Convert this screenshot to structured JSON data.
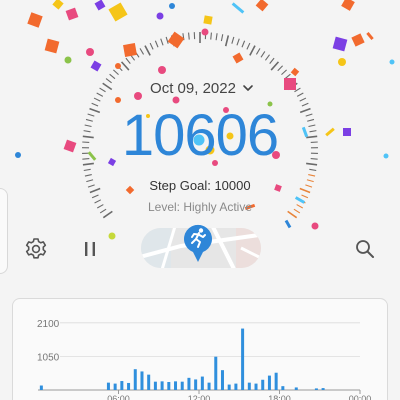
{
  "date": {
    "label": "Oct 09, 2022"
  },
  "steps": {
    "count": "10606",
    "goal_label": "Step Goal: ",
    "goal_value": "10000",
    "level_label": "Level: ",
    "level_value": "Highly Active"
  },
  "colors": {
    "accent": "#2e86d8",
    "gauge_tick": "#6a6a6a",
    "gauge_highlight": "#e8843a",
    "bar": "#2f8fdd"
  },
  "icons": {
    "settings": "gear-icon",
    "pause": "pause-icon",
    "run": "running-person-icon",
    "search": "search-icon",
    "dropdown": "chevron-down-icon"
  },
  "chart_data": {
    "type": "bar",
    "title": "",
    "xlabel": "",
    "ylabel": "",
    "ylim": [
      0,
      2250
    ],
    "y_ticks": [
      "2100",
      "1050"
    ],
    "y_tick_values": [
      2100,
      1050
    ],
    "x_tick_labels": [
      "06:00",
      "12:00",
      "18:00",
      "00:00"
    ],
    "x_tick_hours": [
      6,
      12,
      18,
      24
    ],
    "x_range_hours": [
      0,
      24
    ],
    "bars": [
      {
        "hour": 0.25,
        "value": 140
      },
      {
        "hour": 5.25,
        "value": 230
      },
      {
        "hour": 5.75,
        "value": 200
      },
      {
        "hour": 6.25,
        "value": 280
      },
      {
        "hour": 6.75,
        "value": 220
      },
      {
        "hour": 7.25,
        "value": 650
      },
      {
        "hour": 7.75,
        "value": 580
      },
      {
        "hour": 8.25,
        "value": 480
      },
      {
        "hour": 8.75,
        "value": 260
      },
      {
        "hour": 9.25,
        "value": 270
      },
      {
        "hour": 9.75,
        "value": 250
      },
      {
        "hour": 10.25,
        "value": 270
      },
      {
        "hour": 10.75,
        "value": 260
      },
      {
        "hour": 11.25,
        "value": 380
      },
      {
        "hour": 11.75,
        "value": 330
      },
      {
        "hour": 12.25,
        "value": 420
      },
      {
        "hour": 12.75,
        "value": 230
      },
      {
        "hour": 13.25,
        "value": 1040
      },
      {
        "hour": 13.75,
        "value": 620
      },
      {
        "hour": 14.25,
        "value": 170
      },
      {
        "hour": 14.75,
        "value": 200
      },
      {
        "hour": 15.25,
        "value": 1920
      },
      {
        "hour": 15.75,
        "value": 230
      },
      {
        "hour": 16.25,
        "value": 200
      },
      {
        "hour": 16.75,
        "value": 320
      },
      {
        "hour": 17.25,
        "value": 450
      },
      {
        "hour": 17.75,
        "value": 540
      },
      {
        "hour": 18.25,
        "value": 120
      },
      {
        "hour": 19.25,
        "value": 80
      },
      {
        "hour": 20.75,
        "value": 50
      },
      {
        "hour": 21.25,
        "value": 60
      }
    ]
  }
}
